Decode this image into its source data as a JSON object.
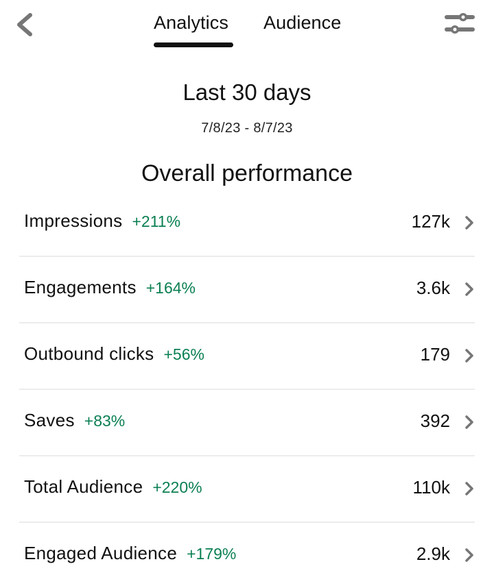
{
  "header": {
    "back_icon": "chevron-left-icon",
    "tabs": [
      {
        "label": "Analytics",
        "active": true
      },
      {
        "label": "Audience",
        "active": false
      }
    ],
    "filter_icon": "sliders-icon"
  },
  "period": {
    "title": "Last 30 days",
    "range": "7/8/23 - 8/7/23"
  },
  "section_title": "Overall performance",
  "colors": {
    "positive_change": "#0a7f52",
    "text": "#111111",
    "icon": "#767676",
    "divider": "#ececec"
  },
  "metrics": [
    {
      "label": "Impressions",
      "change": "+211%",
      "value": "127k"
    },
    {
      "label": "Engagements",
      "change": "+164%",
      "value": "3.6k"
    },
    {
      "label": "Outbound clicks",
      "change": "+56%",
      "value": "179"
    },
    {
      "label": "Saves",
      "change": "+83%",
      "value": "392"
    },
    {
      "label": "Total Audience",
      "change": "+220%",
      "value": "110k"
    },
    {
      "label": "Engaged Audience",
      "change": "+179%",
      "value": "2.9k"
    }
  ]
}
